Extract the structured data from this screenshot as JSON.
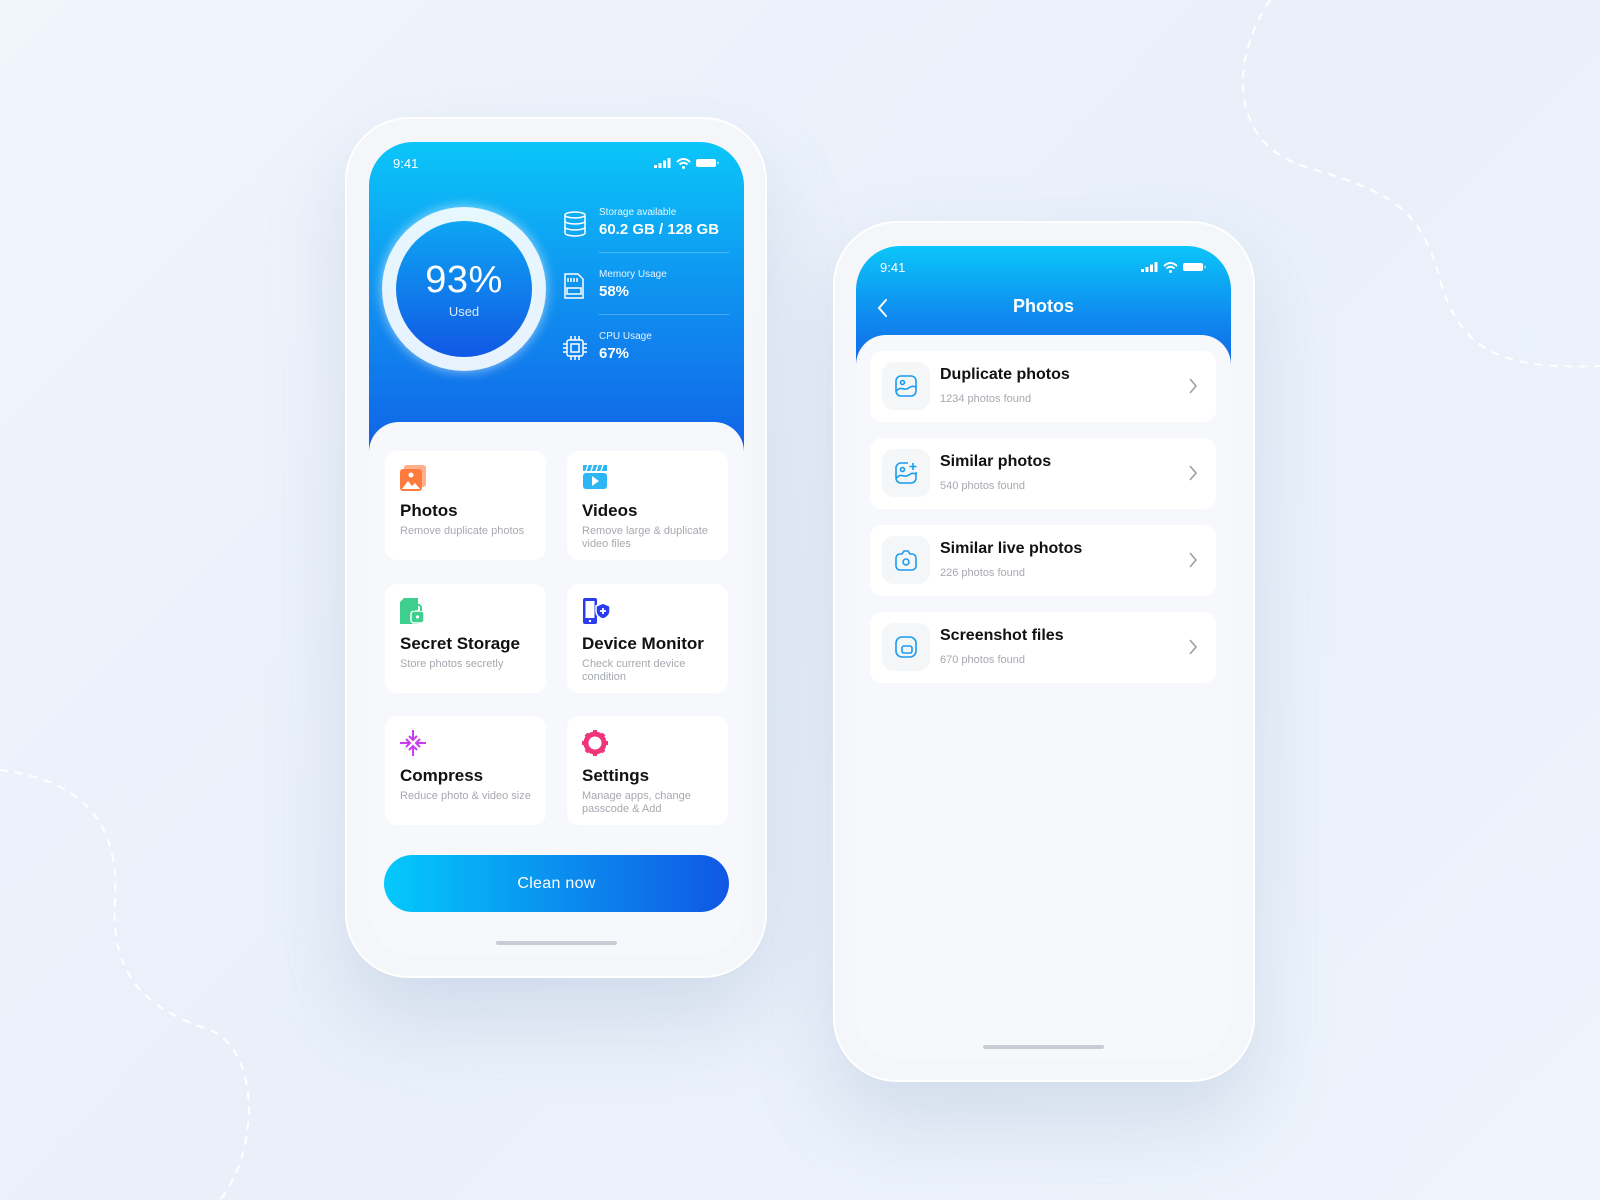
{
  "colors": {
    "header_top": "#0bc6f8",
    "header_bottom": "#1160e6",
    "accent": "#1a9cf0",
    "photos": "#ff7a3d",
    "videos": "#2bb6f5",
    "secret": "#3ecf8e",
    "device": "#2b3cf0",
    "compress": "#c93cf0",
    "settings": "#f0357a"
  },
  "home_screen": {
    "status": {
      "time": "9:41",
      "icons": [
        "signal-icon",
        "wifi-icon",
        "battery-icon"
      ]
    },
    "usage": {
      "percent": "93%",
      "label": "Used",
      "fill": 0.93
    },
    "stats": [
      {
        "icon": "database-icon",
        "label": "Storage available",
        "value": "60.2 GB / 128 GB"
      },
      {
        "icon": "memory-card-icon",
        "label": "Memory Usage",
        "value": "58%"
      },
      {
        "icon": "cpu-icon",
        "label": "CPU Usage",
        "value": "67%"
      }
    ],
    "features": [
      {
        "icon": "photos-icon",
        "title": "Photos",
        "desc": "Remove duplicate photos"
      },
      {
        "icon": "video-clapper-icon",
        "title": "Videos",
        "desc": "Remove large & duplicate video files"
      },
      {
        "icon": "locked-file-icon",
        "title": "Secret Storage",
        "desc": "Store photos secretly"
      },
      {
        "icon": "device-shield-icon",
        "title": "Device Monitor",
        "desc": "Check current device condition"
      },
      {
        "icon": "compress-arrows-icon",
        "title": "Compress",
        "desc": "Reduce photo & video size"
      },
      {
        "icon": "gear-icon",
        "title": "Settings",
        "desc": "Manage apps, change passcode & Add"
      }
    ],
    "clean_button": "Clean now"
  },
  "photos_screen": {
    "status": {
      "time": "9:41"
    },
    "title": "Photos",
    "items": [
      {
        "icon": "image-icon",
        "title": "Duplicate photos",
        "subtitle": "1234 photos found"
      },
      {
        "icon": "image-plus-icon",
        "title": "Similar photos",
        "subtitle": "540 photos found"
      },
      {
        "icon": "camera-icon",
        "title": "Similar live photos",
        "subtitle": "226 photos found"
      },
      {
        "icon": "screenshot-icon",
        "title": "Screenshot files",
        "subtitle": "670 photos found"
      }
    ]
  }
}
